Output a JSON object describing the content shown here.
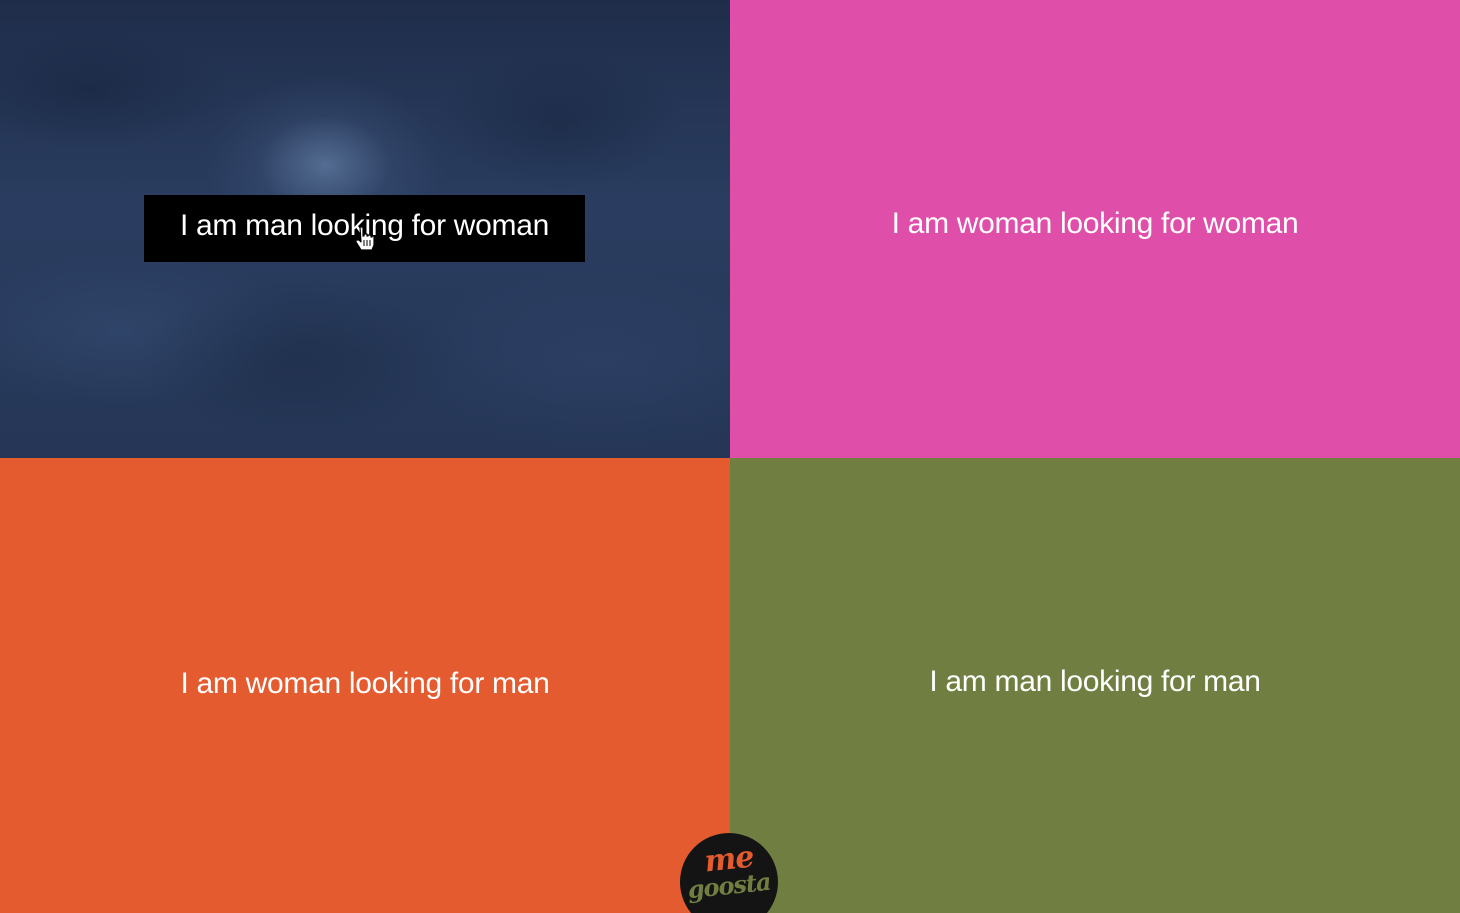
{
  "colors": {
    "top_right": "#df4ea9",
    "bottom_left": "#e35b2e",
    "bottom_right": "#707f41",
    "top_left_base": "#243656",
    "hover_box": "#000000",
    "text": "#ffffff",
    "logo_bg": "#141414",
    "logo_me": "#e35b2e",
    "logo_goosta": "#707f41"
  },
  "options": [
    {
      "label": "I am man looking for woman"
    },
    {
      "label": "I am woman looking for woman"
    },
    {
      "label": "I am woman looking for man"
    },
    {
      "label": "I am man looking for man"
    }
  ],
  "cursor": {
    "icon": "hand-pointer-icon"
  },
  "logo": {
    "line1": "me",
    "line2": "goosta"
  }
}
